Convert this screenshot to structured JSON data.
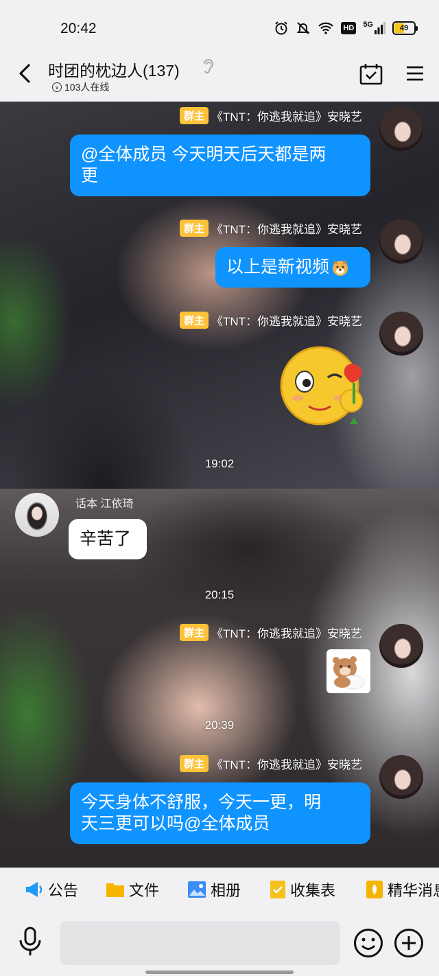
{
  "status_bar": {
    "time": "20:42",
    "network": "5G",
    "hd": "HD",
    "battery": "49",
    "battery_level_percent": 49
  },
  "header": {
    "title": "时团的枕边人(137)",
    "online": "103人在线"
  },
  "messages": [
    {
      "sender_badge": "群主",
      "sender": "《TNT：你逃我就追》安晓艺",
      "text_line1": "@全体成员 今天明天后天都是两",
      "text_line2": "更"
    },
    {
      "sender_badge": "群主",
      "sender": "《TNT：你逃我就追》安晓艺",
      "text": "以上是新视频"
    },
    {
      "sender_badge": "群主",
      "sender": "《TNT：你逃我就追》安晓艺",
      "emoji": "wink-rose-emoji"
    },
    {
      "time": "19:02"
    },
    {
      "sender": "话本 江依琦",
      "text": "辛苦了"
    },
    {
      "time": "20:15"
    },
    {
      "sender_badge": "群主",
      "sender": "《TNT：你逃我就追》安晓艺",
      "sticker": "bear-sticker"
    },
    {
      "time": "20:39"
    },
    {
      "sender_badge": "群主",
      "sender": "《TNT：你逃我就追》安晓艺",
      "text_line1": "今天身体不舒服，今天一更，明",
      "text_line2": "天三更可以吗@全体成员"
    }
  ],
  "shortcuts": [
    {
      "label": "公告",
      "icon": "megaphone-icon",
      "color": "#1e9bf5"
    },
    {
      "label": "文件",
      "icon": "folder-icon",
      "color": "#f7b500"
    },
    {
      "label": "相册",
      "icon": "photo-icon",
      "color": "#3c8df6"
    },
    {
      "label": "收集表",
      "icon": "form-icon",
      "color": "#f5c11a"
    },
    {
      "label": "精华消息",
      "icon": "essence-icon",
      "color": "#f5b400"
    }
  ],
  "colors": {
    "bubble_self": "#0f93ff",
    "owner_badge": "#fdc23a",
    "bar_bg": "#f1f1f3"
  }
}
